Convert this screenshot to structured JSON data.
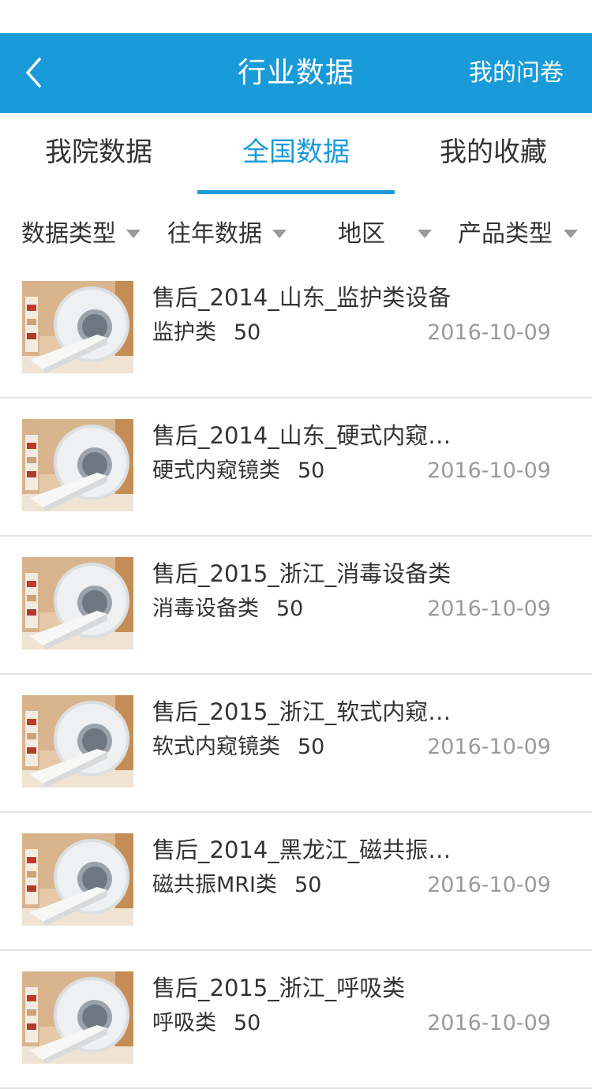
{
  "header": {
    "title": "行业数据",
    "right_action": "我的问卷"
  },
  "tabs": [
    {
      "label": "我院数据",
      "active": false
    },
    {
      "label": "全国数据",
      "active": true
    },
    {
      "label": "我的收藏",
      "active": false
    }
  ],
  "filters": [
    {
      "label": "数据类型"
    },
    {
      "label": "往年数据"
    },
    {
      "label": "地区"
    },
    {
      "label": "产品类型"
    }
  ],
  "items": [
    {
      "title": "售后_2014_山东_监护类设备",
      "category": "监护类",
      "count": "50",
      "date": "2016-10-09"
    },
    {
      "title": "售后_2014_山东_硬式内窥…",
      "category": "硬式内窥镜类",
      "count": "50",
      "date": "2016-10-09"
    },
    {
      "title": "售后_2015_浙江_消毒设备类",
      "category": "消毒设备类",
      "count": "50",
      "date": "2016-10-09"
    },
    {
      "title": "售后_2015_浙江_软式内窥…",
      "category": "软式内窥镜类",
      "count": "50",
      "date": "2016-10-09"
    },
    {
      "title": "售后_2014_黑龙江_磁共振…",
      "category": "磁共振MRI类",
      "count": "50",
      "date": "2016-10-09"
    },
    {
      "title": "售后_2015_浙江_呼吸类",
      "category": "呼吸类",
      "count": "50",
      "date": "2016-10-09"
    }
  ],
  "colors": {
    "accent": "#1a9bd9",
    "divider": "#e2e2e2",
    "muted": "#9a9a9a"
  },
  "icons": {
    "back": "chevron-left-icon",
    "dropdown": "triangle-down-icon",
    "thumbnail": "mri-scanner-image"
  }
}
